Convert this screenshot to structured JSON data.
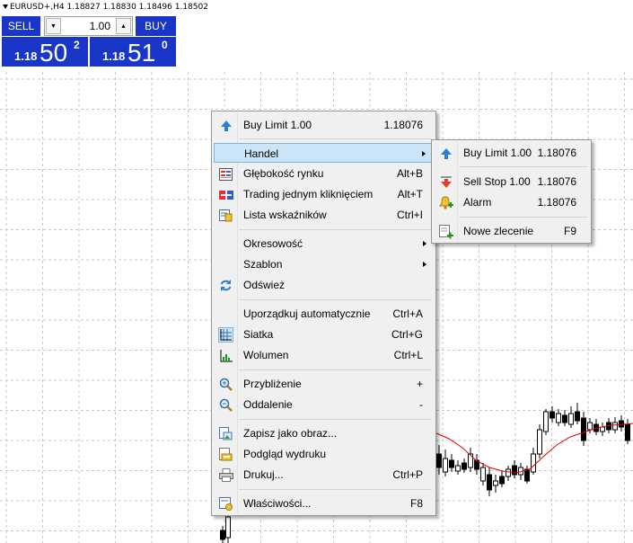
{
  "header": {
    "symbol_info": "EURUSD+,H4  1.18827 1.18830 1.18496 1.18502"
  },
  "trade_panel": {
    "sell_label": "SELL",
    "buy_label": "BUY",
    "lot_value": "1.00",
    "sell_price_prefix": "1.18",
    "sell_price_big": "50",
    "sell_price_sup": "2",
    "buy_price_prefix": "1.18",
    "buy_price_big": "51",
    "buy_price_sup": "0",
    "accent": "#1a36c8"
  },
  "context_menu": {
    "items": [
      {
        "label": "Buy Limit 1.00",
        "shortcut": "1.18076",
        "icon": "buy-limit-icon"
      },
      {
        "label": "Handel",
        "shortcut": "",
        "icon": ""
      },
      {
        "label": "Głębokość rynku",
        "shortcut": "Alt+B",
        "icon": "market-depth-icon"
      },
      {
        "label": "Trading jednym kliknięciem",
        "shortcut": "Alt+T",
        "icon": "one-click-icon"
      },
      {
        "label": "Lista wskaźników",
        "shortcut": "Ctrl+I",
        "icon": "indicator-list-icon"
      },
      {
        "label": "Okresowość",
        "shortcut": "",
        "icon": ""
      },
      {
        "label": "Szablon",
        "shortcut": "",
        "icon": ""
      },
      {
        "label": "Odśwież",
        "shortcut": "",
        "icon": "refresh-icon"
      },
      {
        "label": "Uporządkuj automatycznie",
        "shortcut": "Ctrl+A",
        "icon": ""
      },
      {
        "label": "Siatka",
        "shortcut": "Ctrl+G",
        "icon": "grid-icon"
      },
      {
        "label": "Wolumen",
        "shortcut": "Ctrl+L",
        "icon": "volume-icon"
      },
      {
        "label": "Przybliżenie",
        "shortcut": "+",
        "icon": "zoom-in-icon"
      },
      {
        "label": "Oddalenie",
        "shortcut": "-",
        "icon": "zoom-out-icon"
      },
      {
        "label": "Zapisz jako obraz...",
        "shortcut": "",
        "icon": "save-image-icon"
      },
      {
        "label": "Podgląd wydruku",
        "shortcut": "",
        "icon": "print-preview-icon"
      },
      {
        "label": "Drukuj...",
        "shortcut": "Ctrl+P",
        "icon": "print-icon"
      },
      {
        "label": "Właściwości...",
        "shortcut": "F8",
        "icon": "properties-icon"
      }
    ]
  },
  "submenu": {
    "items": [
      {
        "label": "Buy Limit 1.00",
        "shortcut": "1.18076",
        "icon": "buy-limit-icon"
      },
      {
        "label": "Sell Stop 1.00",
        "shortcut": "1.18076",
        "icon": "sell-stop-icon"
      },
      {
        "label": "Alarm",
        "shortcut": "1.18076",
        "icon": "alarm-icon"
      },
      {
        "label": "Nowe zlecenie",
        "shortcut": "F9",
        "icon": "new-order-icon"
      }
    ]
  }
}
